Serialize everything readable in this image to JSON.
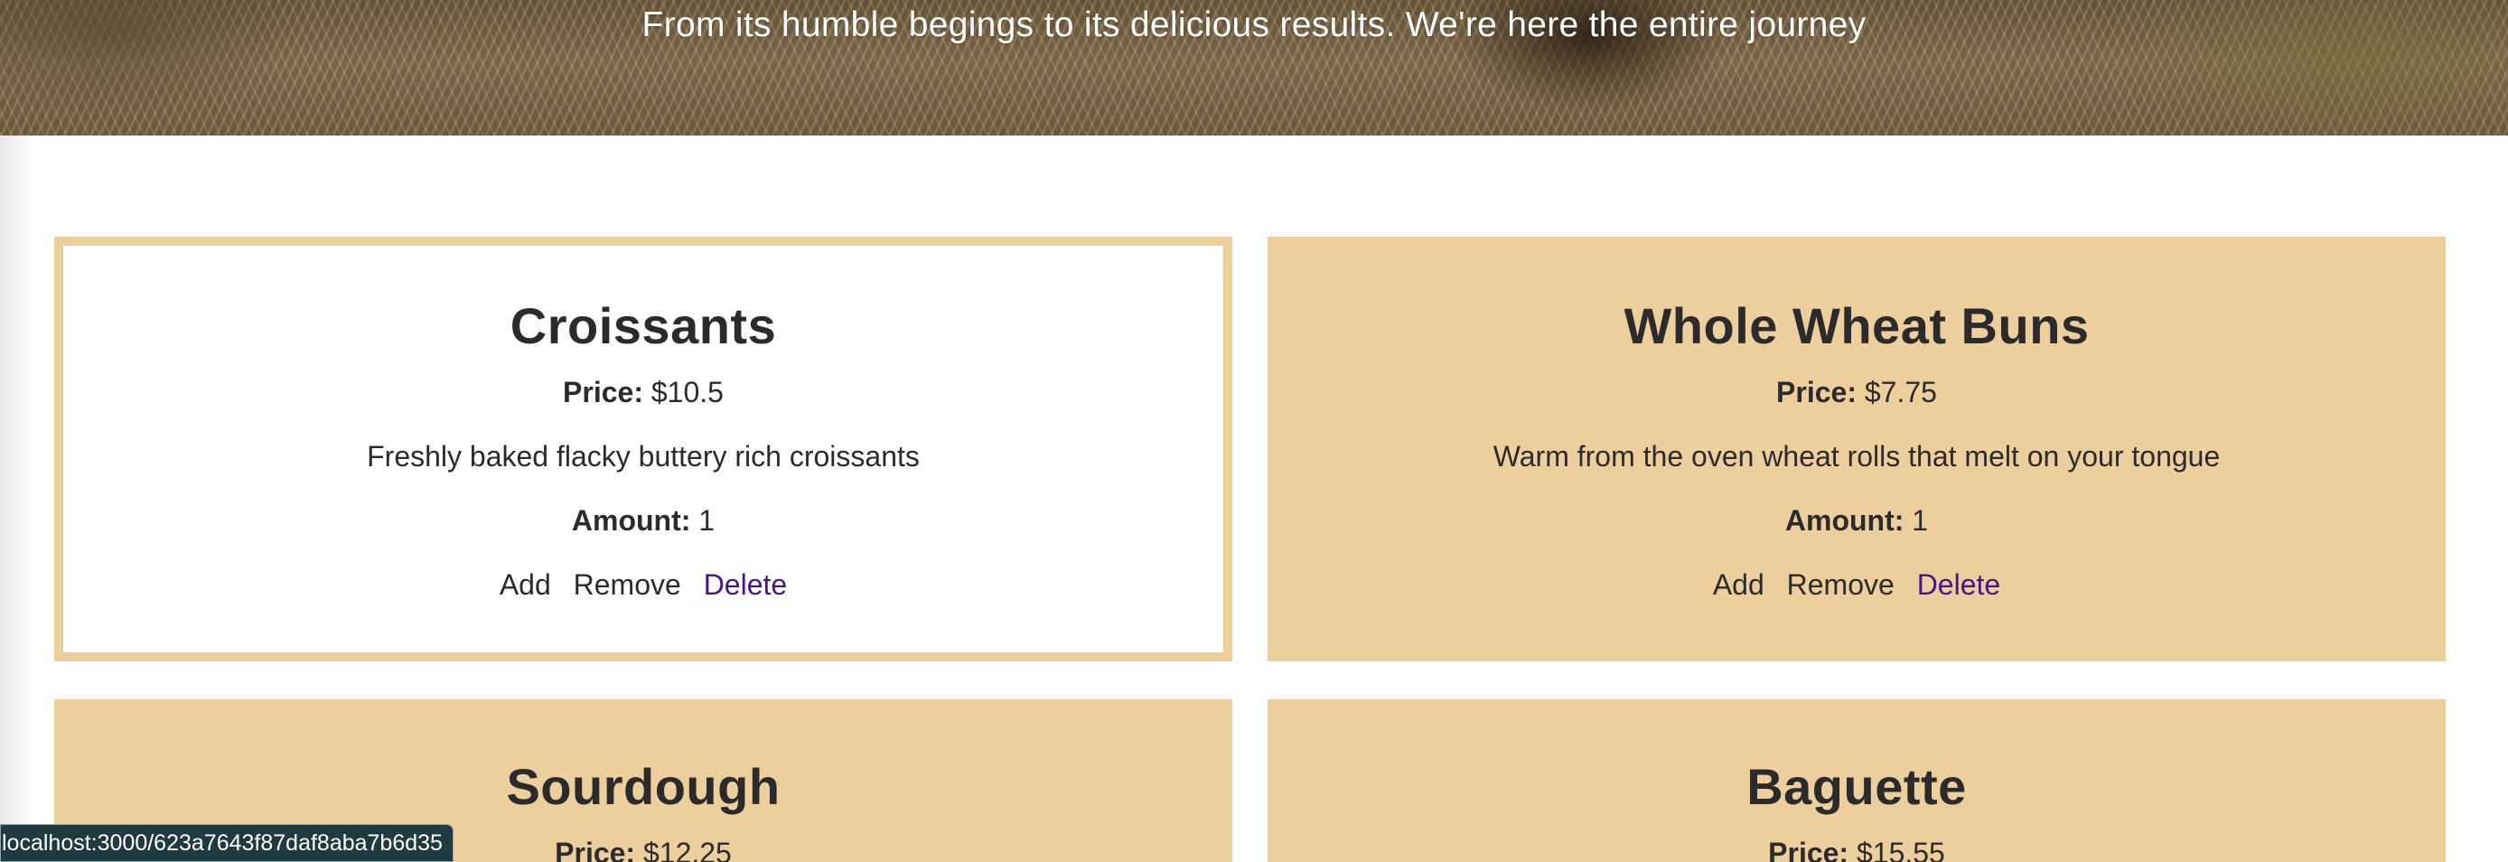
{
  "hero": {
    "tagline": "From its humble begings to its delicious results. We're here the entire journey"
  },
  "products": [
    {
      "name": "Croissants",
      "price_label": "Price:",
      "price": "$10.5",
      "description": "Freshly baked flacky buttery rich croissants",
      "amount_label": "Amount:",
      "amount": "1",
      "add_label": "Add",
      "remove_label": "Remove",
      "delete_label": "Delete"
    },
    {
      "name": "Whole Wheat Buns",
      "price_label": "Price:",
      "price": "$7.75",
      "description": "Warm from the oven wheat rolls that melt on your tongue",
      "amount_label": "Amount:",
      "amount": "1",
      "add_label": "Add",
      "remove_label": "Remove",
      "delete_label": "Delete"
    },
    {
      "name": "Sourdough",
      "price_label": "Price:",
      "price": "$12.25"
    },
    {
      "name": "Baguette",
      "price_label": "Price:",
      "price": "$15.55"
    }
  ],
  "status_bar": {
    "url": "localhost:3000/623a7643f87daf8aba7b6d35"
  },
  "colors": {
    "card_background": "#edcf9e",
    "delete_link": "#4b1387",
    "text": "#2b2b2b"
  }
}
